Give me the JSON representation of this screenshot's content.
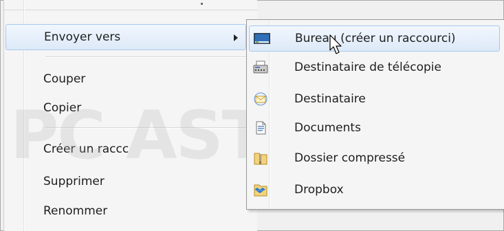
{
  "menu": {
    "items": [
      {
        "label": "Envoyer vers",
        "has_submenu": true,
        "highlighted": true
      },
      {
        "label": "Couper"
      },
      {
        "label": "Copier"
      },
      {
        "label": "Créer un raccc"
      },
      {
        "label": "Supprimer"
      },
      {
        "label": "Renommer"
      }
    ]
  },
  "submenu": {
    "items": [
      {
        "label": "Bureau (créer un raccourci)",
        "icon": "desktop-icon",
        "highlighted": true
      },
      {
        "label": "Destinataire de télécopie",
        "icon": "fax-icon"
      },
      {
        "label": "Destinataire",
        "icon": "mail-recipient-icon"
      },
      {
        "label": "Documents",
        "icon": "documents-icon"
      },
      {
        "label": "Dossier compressé",
        "icon": "zip-folder-icon"
      },
      {
        "label": "Dropbox",
        "icon": "dropbox-icon"
      }
    ]
  },
  "watermark": {
    "text": "PC ASTUCES"
  },
  "colors": {
    "highlight_border": "#a8c8ef",
    "highlight_fill": "#dde9f8",
    "menu_bg": "#f5f5f5"
  }
}
